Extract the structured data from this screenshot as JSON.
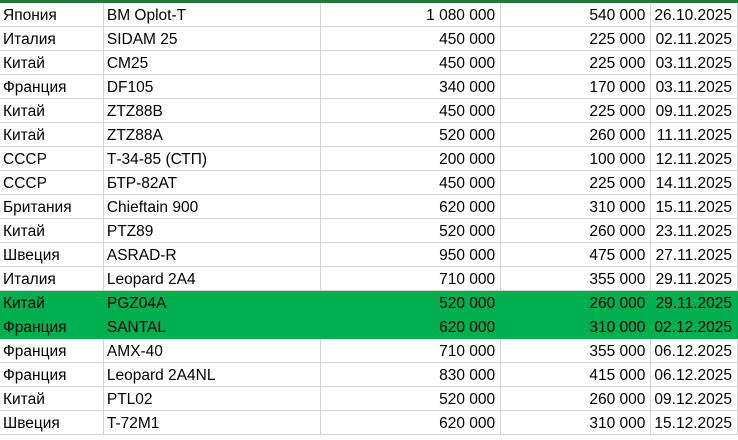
{
  "sheet": {
    "highlight_color": "#00b050",
    "rows": [
      {
        "country": "Япония",
        "model": "BM Oplot-T",
        "price": "1 080 000",
        "half": "540 000",
        "date": "26.10.2025",
        "highlight": false
      },
      {
        "country": "Италия",
        "model": "SIDAM 25",
        "price": "450 000",
        "half": "225 000",
        "date": "02.11.2025",
        "highlight": false
      },
      {
        "country": "Китай",
        "model": "CM25",
        "price": "450 000",
        "half": "225 000",
        "date": "03.11.2025",
        "highlight": false
      },
      {
        "country": "Франция",
        "model": "DF105",
        "price": "340 000",
        "half": "170 000",
        "date": "03.11.2025",
        "highlight": false
      },
      {
        "country": "Китай",
        "model": "ZTZ88B",
        "price": "450 000",
        "half": "225 000",
        "date": "09.11.2025",
        "highlight": false
      },
      {
        "country": "Китай",
        "model": "ZTZ88A",
        "price": "520 000",
        "half": "260 000",
        "date": "11.11.2025",
        "highlight": false
      },
      {
        "country": "СССР",
        "model": "Т-34-85 (СТП)",
        "price": "200 000",
        "half": "100 000",
        "date": "12.11.2025",
        "highlight": false
      },
      {
        "country": "СССР",
        "model": "БТР-82АТ",
        "price": "450 000",
        "half": "225 000",
        "date": "14.11.2025",
        "highlight": false
      },
      {
        "country": "Британия",
        "model": "Chieftain 900",
        "price": "620 000",
        "half": "310 000",
        "date": "15.11.2025",
        "highlight": false
      },
      {
        "country": "Китай",
        "model": "PTZ89",
        "price": "520 000",
        "half": "260 000",
        "date": "23.11.2025",
        "highlight": false
      },
      {
        "country": "Швеция",
        "model": "ASRAD-R",
        "price": "950 000",
        "half": "475 000",
        "date": "27.11.2025",
        "highlight": false
      },
      {
        "country": "Италия",
        "model": "Leopard 2A4",
        "price": "710 000",
        "half": "355 000",
        "date": "29.11.2025",
        "highlight": false
      },
      {
        "country": "Китай",
        "model": "PGZ04A",
        "price": "520 000",
        "half": "260 000",
        "date": "29.11.2025",
        "highlight": true
      },
      {
        "country": "Франция",
        "model": "SANTAL",
        "price": "620 000",
        "half": "310 000",
        "date": "02.12.2025",
        "highlight": true
      },
      {
        "country": "Франция",
        "model": "AMX-40",
        "price": "710 000",
        "half": "355 000",
        "date": "06.12.2025",
        "highlight": false
      },
      {
        "country": "Франция",
        "model": "Leopard 2A4NL",
        "price": "830 000",
        "half": "415 000",
        "date": "06.12.2025",
        "highlight": false
      },
      {
        "country": "Китай",
        "model": "PTL02",
        "price": "520 000",
        "half": "260 000",
        "date": "09.12.2025",
        "highlight": false
      },
      {
        "country": "Швеция",
        "model": "T-72M1",
        "price": "620 000",
        "half": "310 000",
        "date": "15.12.2025",
        "highlight": false
      }
    ]
  }
}
